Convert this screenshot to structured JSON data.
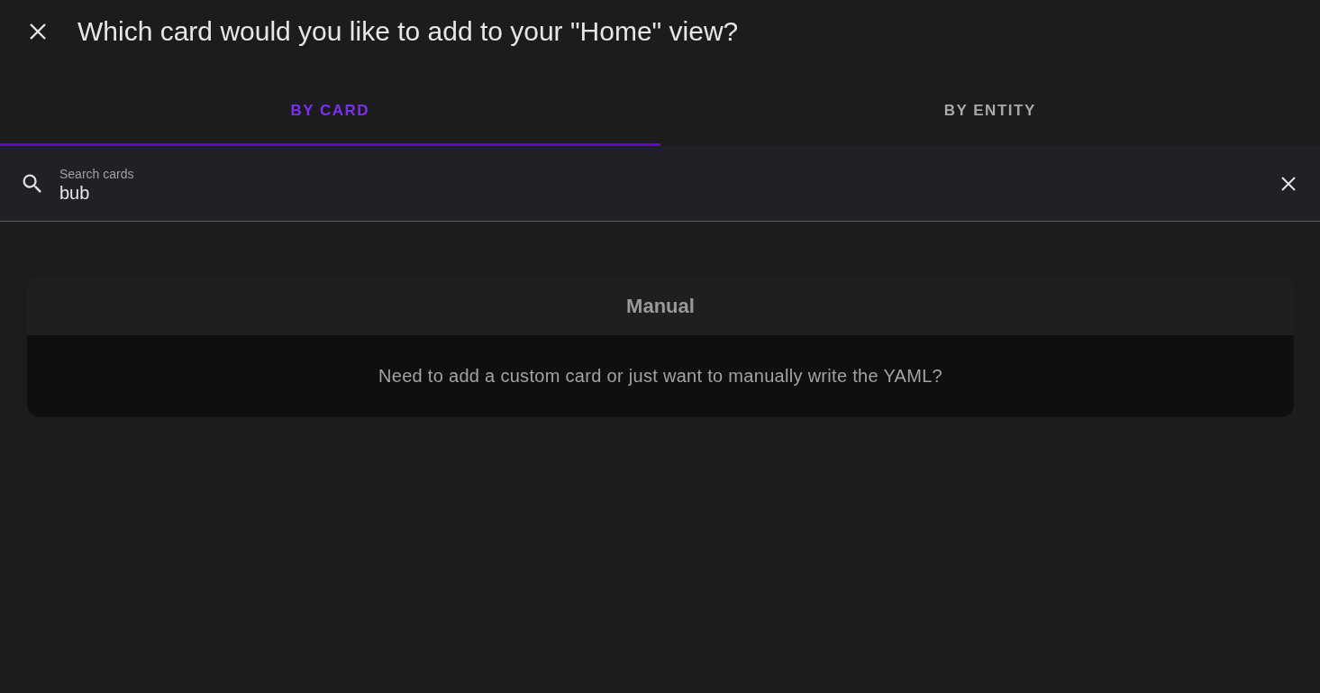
{
  "dialog": {
    "title": "Which card would you like to add to your \"Home\" view?"
  },
  "tabs": [
    {
      "label": "BY CARD",
      "selected": true
    },
    {
      "label": "BY ENTITY",
      "selected": false
    }
  ],
  "search": {
    "label": "Search cards",
    "value": "bub"
  },
  "cards": [
    {
      "title": "Manual",
      "description": "Need to add a custom card or just want to manually write the YAML?"
    }
  ]
}
